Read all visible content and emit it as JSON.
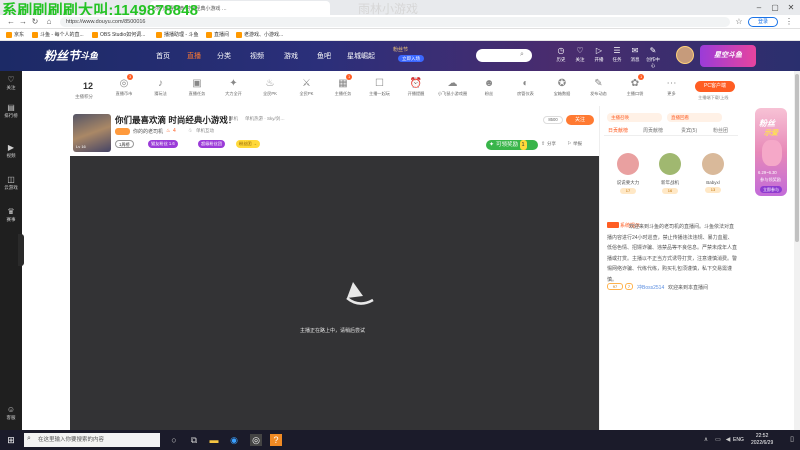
{
  "overlay_text": "系刷刷刷刷大叫:1149878848",
  "watermark": "雨林小游戏",
  "browser": {
    "tab1": "你们最喜欢滴 时尚经典小游戏 …",
    "tab2": "",
    "url": "https://www.douyu.com/8500016",
    "login_label": "登录"
  },
  "bookmarks": [
    {
      "label": "京东"
    },
    {
      "label": "斗鱼 - 每个人的直..."
    },
    {
      "label": "OBS Studio如何调..."
    },
    {
      "label": "播播助理 - 斗鱼"
    },
    {
      "label": "直播间"
    },
    {
      "label": "老游戏、小游戏..."
    }
  ],
  "header": {
    "logo": "粉丝节",
    "logo2": "斗鱼",
    "nav": [
      "首页",
      "直播",
      "分类",
      "视频",
      "游戏",
      "鱼吧",
      "星城崛起"
    ],
    "fenzijie_title": "粉丝节",
    "fenzijie_badge": "立即入场",
    "search_placeholder": "",
    "icons": [
      {
        "name": "history-icon",
        "label": "历史",
        "glyph": "◷"
      },
      {
        "name": "follow-icon",
        "label": "关注",
        "glyph": "♡"
      },
      {
        "name": "live-icon",
        "label": "开播",
        "glyph": "▷"
      },
      {
        "name": "task-icon",
        "label": "任务",
        "glyph": "☰"
      },
      {
        "name": "message-icon",
        "label": "消息",
        "glyph": "✉"
      },
      {
        "name": "creator-icon",
        "label": "创作中心",
        "glyph": "✎"
      }
    ],
    "promo": "星空斗鱼"
  },
  "left_sidebar": [
    {
      "name": "follow",
      "label": "关注",
      "glyph": "♡"
    },
    {
      "name": "ranking",
      "label": "排行榜",
      "glyph": "▤"
    },
    {
      "name": "video",
      "label": "视频",
      "glyph": "▶"
    },
    {
      "name": "game",
      "label": "云游戏",
      "glyph": "◫"
    },
    {
      "name": "shop",
      "label": "赛事",
      "glyph": "♛"
    },
    {
      "name": "settings",
      "label": "客服",
      "glyph": "☺"
    }
  ],
  "toolbar": {
    "score_num": "12",
    "score_label": "主播积分",
    "items": [
      {
        "name": "fan-medal",
        "label": "直播币市",
        "glyph": "◎",
        "badge": "3"
      },
      {
        "name": "quiz",
        "label": "猜玩法",
        "glyph": "♪"
      },
      {
        "name": "interact",
        "label": "直播任务",
        "glyph": "▣"
      },
      {
        "name": "gift",
        "label": "大力全开",
        "glyph": "✦"
      },
      {
        "name": "fire",
        "label": "全民PK",
        "glyph": "♨"
      },
      {
        "name": "pk",
        "label": "全民PK",
        "glyph": "⚔"
      },
      {
        "name": "task",
        "label": "主播任务",
        "glyph": "▦",
        "badge": "1"
      },
      {
        "name": "book",
        "label": "主播一起玩",
        "glyph": "☐"
      },
      {
        "name": "alarm",
        "label": "开播提醒",
        "glyph": "⏰"
      },
      {
        "name": "cloud",
        "label": "小飞鼠小游戏圈",
        "glyph": "☁"
      },
      {
        "name": "user",
        "label": "粉丝",
        "glyph": "☻"
      },
      {
        "name": "dashboard",
        "label": "房管仪表",
        "glyph": "◐"
      },
      {
        "name": "treasure",
        "label": "宝箱数据",
        "glyph": "✪"
      },
      {
        "name": "edit",
        "label": "发布动态",
        "glyph": "✎"
      },
      {
        "name": "entry",
        "label": "主播口袋",
        "glyph": "✿",
        "badge": "1"
      },
      {
        "name": "more",
        "label": "更多",
        "glyph": "⋯"
      }
    ],
    "pc_button": "PC客户端",
    "pc_sub": "主播端下载/上线"
  },
  "stream": {
    "title": "你们最喜欢滴 时尚经典小游戏！",
    "tag_category": "单机",
    "tag_sub": "单机热游 · Sky/剑…",
    "lvl": "",
    "streamer_name": "你的的老司机",
    "hot": "4",
    "category_label": "单机互动",
    "thumb_lv": "Lv 16",
    "pill1": "1周榜",
    "pill2": "猫友粉丝 1.6",
    "pill3": "超级粉丝团",
    "pill4": "粉丝团 →",
    "rank_id": "8500",
    "follow_label": "关注",
    "pending_label": "可领奖励",
    "pending_num": "1",
    "share_label": "分享",
    "report_label": "举报"
  },
  "video": {
    "offline_text": "主播正在路上中，请稍后尝试"
  },
  "right_panel": {
    "tag_a": "主播召唤",
    "tag_b": "直播回看",
    "tabs": [
      "日贡献榜",
      "周贡献榜",
      "贵宾(5)",
      "粉丝团"
    ],
    "fans": [
      {
        "name": "说说要大力",
        "lv": "17",
        "color": "#e9a0a0"
      },
      {
        "name": "新年战机",
        "lv": "16",
        "color": "#a0b870"
      },
      {
        "name": "Babyxl",
        "lv": "13",
        "color": "#d9b99a"
      }
    ],
    "chat_tag": "系统提示",
    "chat_text": "欢迎来到斗鱼的老司机的直播间。斗鱼依法对直播内容进行24小时巡查，禁止传播违法违规、暴力血腥、低俗色情、招嫖诈骗、违禁品等不良信息。严禁未成年人直播或打赏。主播以不正当方式诱导打赏，注意谨慎消费。警惕网络诈骗、代练代练，购买礼包须谨慎，私下交易需谨慎。",
    "chat2_lv1": "97",
    "chat2_lv2": "7",
    "chat2_user": "冲Boss2514",
    "chat2_msg": "欢迎来到本直播间"
  },
  "right_promo": {
    "title": "粉丝",
    "title2": "示爱",
    "date": "6.29~6.30",
    "sub": "参与领奖励",
    "btn": "立即参与"
  },
  "taskbar": {
    "search_placeholder": "在这里输入你要搜索的内容",
    "lang": "ENG",
    "time": "22:52",
    "date": "2022/6/29"
  }
}
